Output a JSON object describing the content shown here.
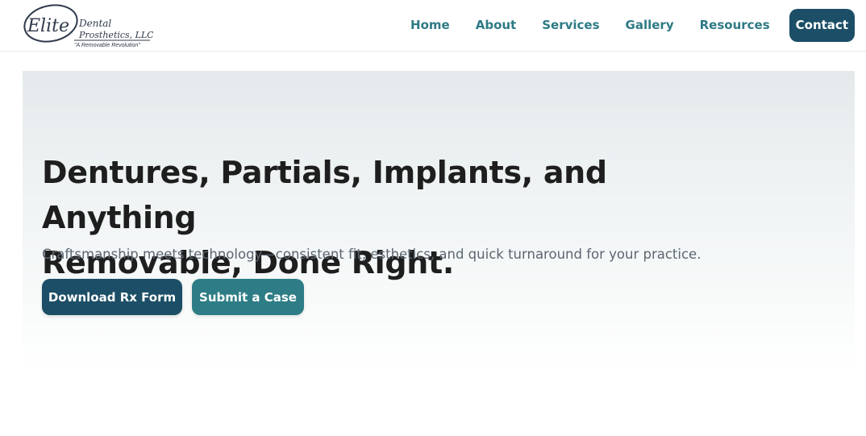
{
  "header": {
    "logo": {
      "brand": "Elite",
      "line1": "Dental",
      "line2": "Prosthetics, LLC",
      "tagline": "\"A Removable Revolution\""
    },
    "nav": [
      {
        "label": "Home"
      },
      {
        "label": "About"
      },
      {
        "label": "Services"
      },
      {
        "label": "Gallery"
      },
      {
        "label": "Resources"
      }
    ],
    "contact_label": "Contact"
  },
  "hero": {
    "title_line1": "Dentures, Partials, Implants, and Anything",
    "title_line2": "Removable, Done Right.",
    "subtitle": "Craftsmanship meets technology—consistent fit, esthetics, and quick turnaround for your practice.",
    "primary_button": "Download Rx Form",
    "secondary_button": "Submit a Case"
  },
  "colors": {
    "primary": "#1c4f67",
    "secondary": "#2e7d86",
    "nav_link": "#2e7a86",
    "title": "#1e1e1e",
    "subtitle": "#5b6670"
  }
}
